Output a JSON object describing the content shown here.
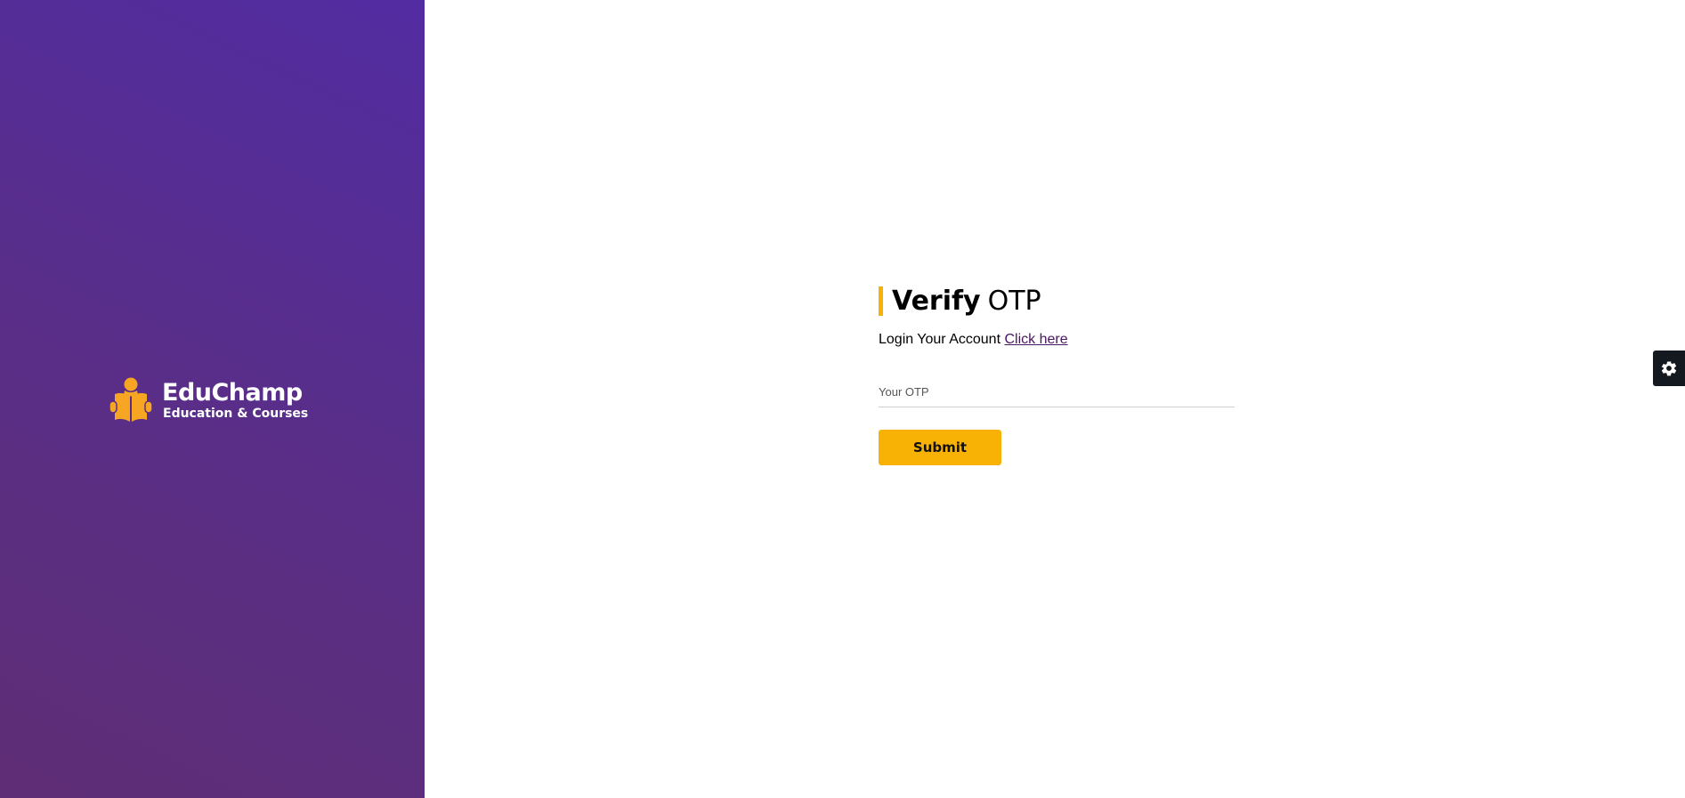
{
  "brand": {
    "name": "EduChamp",
    "tagline": "Education & Courses"
  },
  "form": {
    "title_strong": "Verify",
    "title_light": "OTP",
    "login_prompt": "Login Your Account",
    "login_link": "Click here",
    "otp_placeholder": "Your OTP",
    "otp_value": "",
    "submit_label": "Submit"
  },
  "icons": {
    "logo": "reader-book-icon",
    "settings": "gear-icon"
  },
  "colors": {
    "panel_gradient_start": "#5e2d75",
    "panel_gradient_end": "#522ca1",
    "accent": "#f7b205",
    "link": "#4a1562",
    "settings_tab": "#13191f"
  }
}
